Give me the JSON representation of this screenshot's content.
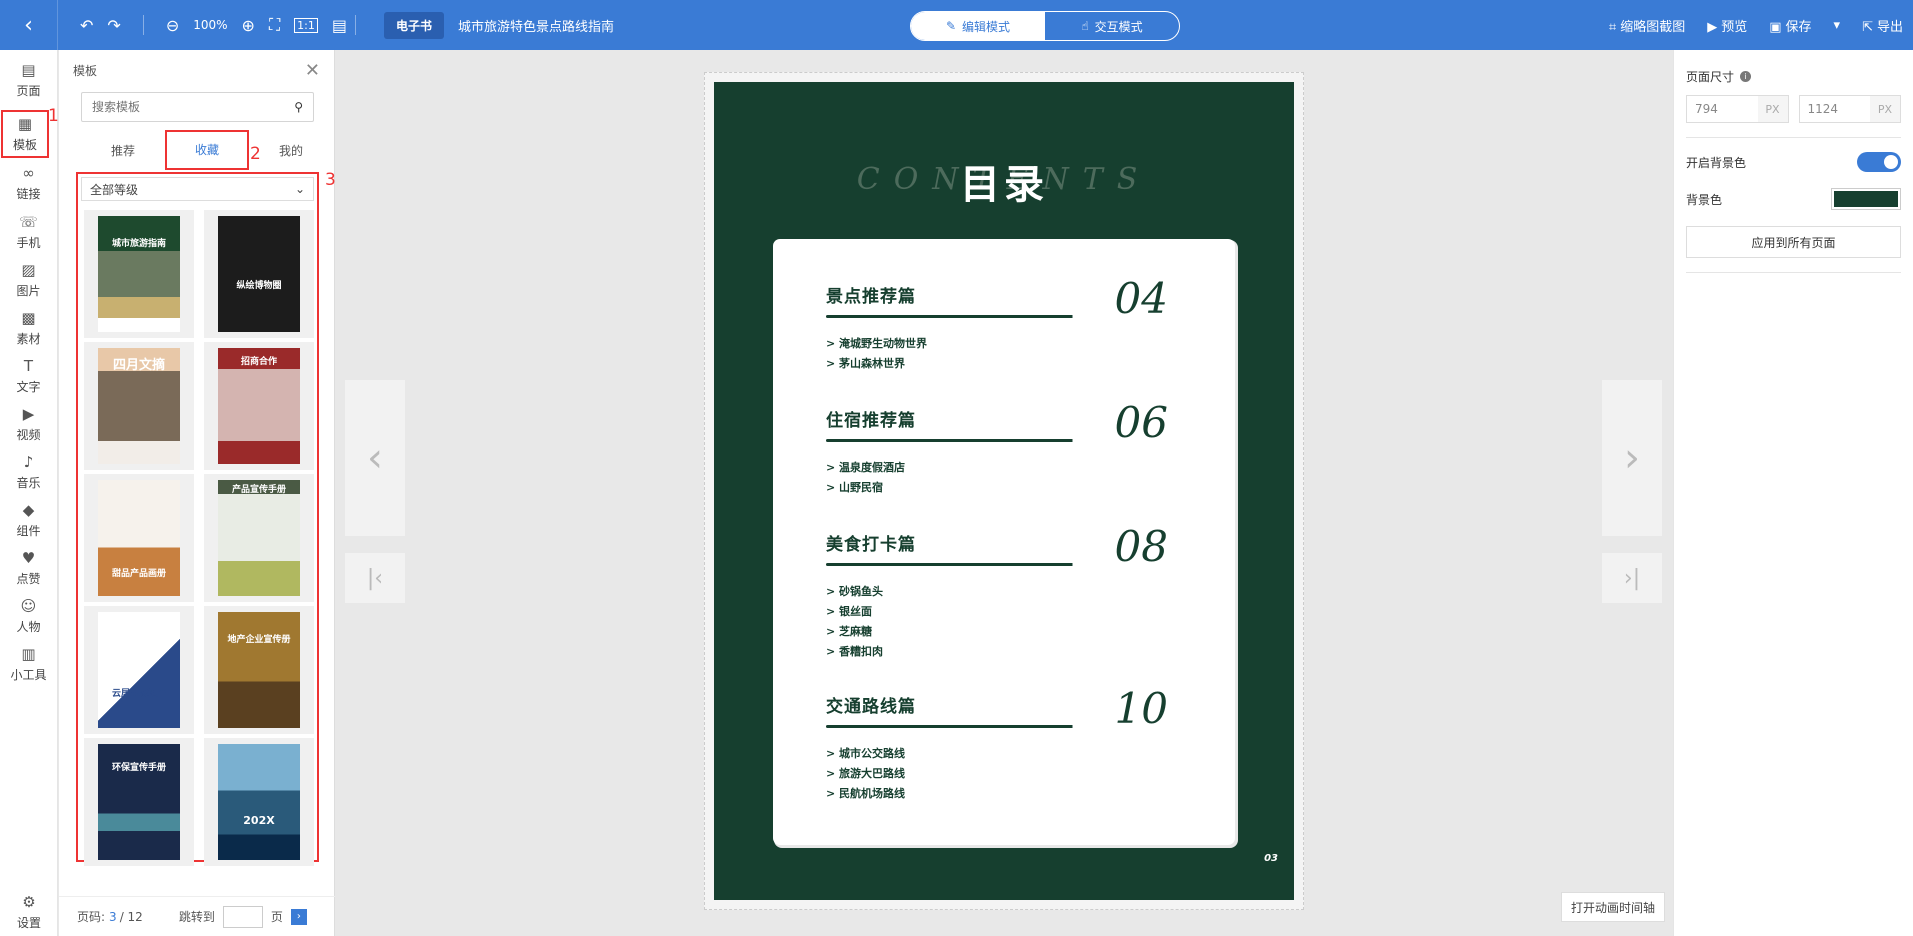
{
  "topbar": {
    "zoom": "100%",
    "doc_type": "电子书",
    "doc_title": "城市旅游特色景点路线指南",
    "mode_edit": "编辑模式",
    "mode_interact": "交互模式",
    "thumbnail": "缩略图截图",
    "preview": "预览",
    "save": "保存",
    "export": "导出"
  },
  "leftnav": {
    "items": [
      "页面",
      "模板",
      "链接",
      "手机",
      "图片",
      "素材",
      "文字",
      "视频",
      "音乐",
      "组件",
      "点赞",
      "人物",
      "小工具"
    ],
    "settings": "设置"
  },
  "panel": {
    "title": "模板",
    "search_placeholder": "搜索模板",
    "tabs": [
      "推荐",
      "收藏",
      "我的"
    ],
    "filter": "全部等级",
    "thumbs": [
      "城市旅游指南",
      "纵绘博物圈",
      "四月文摘",
      "招商合作",
      "甜品产品画册",
      "产品宣传手册",
      "云居生态地产",
      "地产企业宣传册",
      "环保宣传手册",
      "202X"
    ],
    "pager": {
      "label": "页码:",
      "current": "3",
      "total": "/ 12",
      "jump": "跳转到",
      "unit": "页"
    }
  },
  "annotations": [
    "1",
    "2",
    "3"
  ],
  "page": {
    "contents": "CONTENTS",
    "title": "目录",
    "page_number": "03",
    "sections": [
      {
        "title": "景点推荐篇",
        "num": "04",
        "items": [
          "> 淹城野生动物世界",
          "> 茅山森林世界"
        ]
      },
      {
        "title": "住宿推荐篇",
        "num": "06",
        "items": [
          "> 温泉度假酒店",
          "> 山野民宿"
        ]
      },
      {
        "title": "美食打卡篇",
        "num": "08",
        "items": [
          "> 砂锅鱼头",
          "> 银丝面",
          "> 芝麻糖",
          "> 香糟扣肉"
        ]
      },
      {
        "title": "交通路线篇",
        "num": "10",
        "items": [
          "> 城市公交路线",
          "> 旅游大巴路线",
          "> 民航机场路线"
        ]
      }
    ]
  },
  "timeline_btn": "打开动画时间轴",
  "rpanel": {
    "page_size": "页面尺寸",
    "width": "794",
    "height": "1124",
    "unit": "PX",
    "bg_toggle": "开启背景色",
    "bg_color_label": "背景色",
    "bg_color": "#163f2f",
    "apply": "应用到所有页面"
  }
}
